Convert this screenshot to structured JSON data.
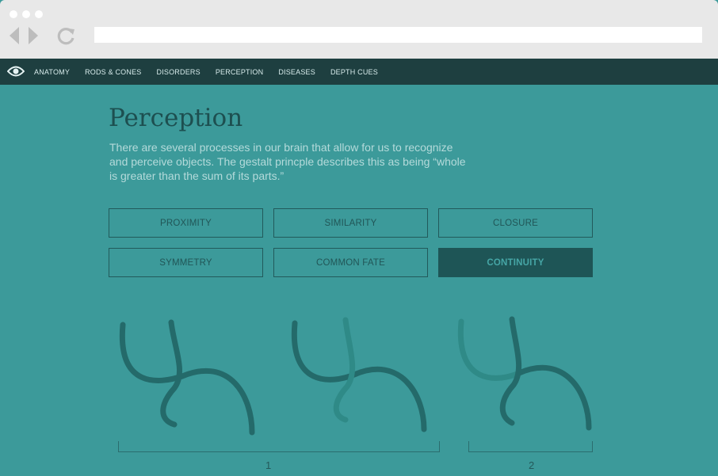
{
  "browser": {
    "address_value": "",
    "icons": [
      "back-icon",
      "forward-icon",
      "reload-icon"
    ]
  },
  "nav": {
    "logo_icon": "eye-icon",
    "items": [
      "ANATOMY",
      "RODS & CONES",
      "DISORDERS",
      "PERCEPTION",
      "DISEASES",
      "DEPTH CUES"
    ]
  },
  "page": {
    "title": "Perception",
    "intro": "There are several processes in our brain that allow for us to recognize and perceive objects. The gestalt princple describes this as being “whole is greater than the sum of its parts.”"
  },
  "principles": {
    "items": [
      "PROXIMITY",
      "SIMILARITY",
      "CLOSURE",
      "SYMMETRY",
      "COMMON FATE",
      "CONTINUITY"
    ],
    "selected": "CONTINUITY"
  },
  "figures": {
    "labels": [
      "1",
      "2"
    ]
  },
  "colors": {
    "background": "#3c9a9a",
    "nav_bar": "#1e3f40",
    "title": "#1d4f50",
    "stroke_dark": "#246a6a",
    "stroke_light": "#2f8a87",
    "active_chip": "#1e5556"
  }
}
